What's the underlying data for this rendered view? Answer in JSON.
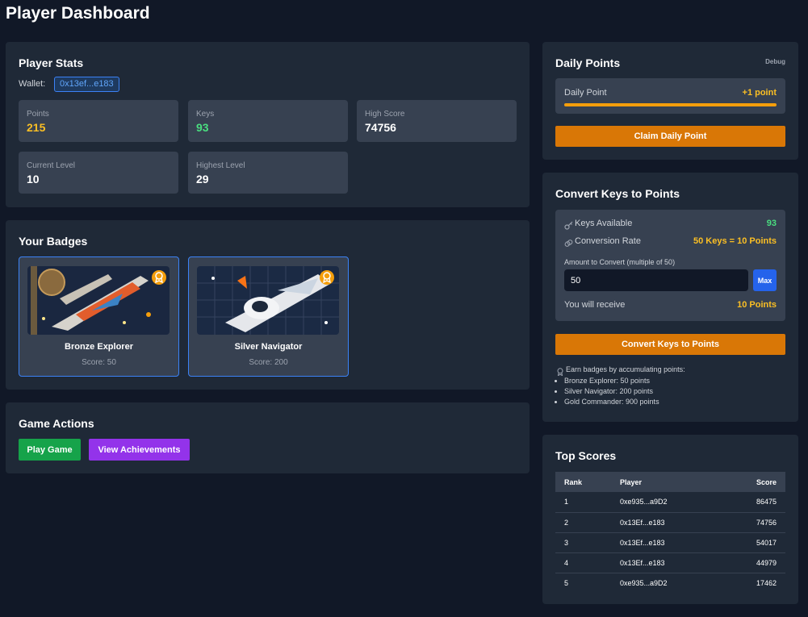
{
  "page": {
    "title": "Player Dashboard"
  },
  "player_stats": {
    "title": "Player Stats",
    "wallet_label": "Wallet:",
    "wallet_address": "0x13ef...e183",
    "stats": [
      {
        "label": "Points",
        "value": "215",
        "color": "#fbbf24"
      },
      {
        "label": "Keys",
        "value": "93",
        "color": "#4ade80"
      },
      {
        "label": "High Score",
        "value": "74756",
        "color": "#ffffff"
      },
      {
        "label": "Current Level",
        "value": "10",
        "color": "#ffffff"
      },
      {
        "label": "Highest Level",
        "value": "29",
        "color": "#ffffff"
      }
    ]
  },
  "badges": {
    "title": "Your Badges",
    "items": [
      {
        "name": "Bronze Explorer",
        "score": "Score: 50",
        "icon": "medal-icon"
      },
      {
        "name": "Silver Navigator",
        "score": "Score: 200",
        "icon": "medal-icon"
      }
    ]
  },
  "game_actions": {
    "title": "Game Actions",
    "play_label": "Play Game",
    "achievements_label": "View Achievements",
    "play_color": "#16a34a",
    "achievements_color": "#9333ea"
  },
  "daily_points": {
    "title": "Daily Points",
    "debug_label": "Debug",
    "row_label": "Daily Point",
    "row_value": "+1 point",
    "progress": 1.0,
    "claim_label": "Claim Daily Point",
    "accent": "#d97706"
  },
  "convert": {
    "title": "Convert Keys to Points",
    "keys_label": "Keys Available",
    "keys_value": "93",
    "keys_icon": "key-icon",
    "rate_label": "Conversion Rate",
    "rate_value": "50 Keys = 10 Points",
    "rate_icon": "exchange-icon",
    "amount_label": "Amount to Convert (multiple of 50)",
    "amount_value": "50",
    "max_label": "Max",
    "receive_label": "You will receive",
    "receive_value": "10 Points",
    "button_label": "Convert Keys to Points",
    "info_text": "Earn badges by accumulating points:",
    "info_icon": "award-icon",
    "info_items": [
      "Bronze Explorer: 50 points",
      "Silver Navigator: 200 points",
      "Gold Commander: 900 points"
    ]
  },
  "top_scores": {
    "title": "Top Scores",
    "headers": {
      "rank": "Rank",
      "player": "Player",
      "score": "Score"
    },
    "rows": [
      {
        "rank": "1",
        "player": "0xe935...a9D2",
        "score": "86475"
      },
      {
        "rank": "2",
        "player": "0x13Ef...e183",
        "score": "74756"
      },
      {
        "rank": "3",
        "player": "0x13Ef...e183",
        "score": "54017"
      },
      {
        "rank": "4",
        "player": "0x13Ef...e183",
        "score": "44979"
      },
      {
        "rank": "5",
        "player": "0xe935...a9D2",
        "score": "17462"
      }
    ]
  }
}
